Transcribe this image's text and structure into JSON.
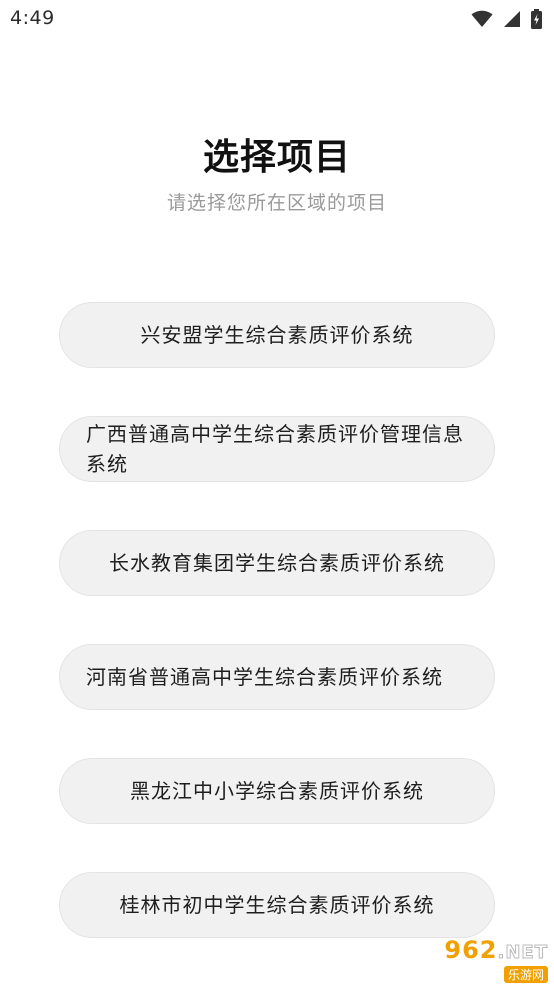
{
  "status_bar": {
    "time": "4:49",
    "icons": [
      "wifi-icon",
      "signal-icon",
      "battery-charging-icon"
    ]
  },
  "header": {
    "title": "选择项目",
    "subtitle": "请选择您所在区域的项目"
  },
  "projects": [
    {
      "label": "兴安盟学生综合素质评价系统"
    },
    {
      "label": "广西普通高中学生综合素质评价管理信息系统"
    },
    {
      "label": "长水教育集团学生综合素质评价系统"
    },
    {
      "label": "河南省普通高中学生综合素质评价系统"
    },
    {
      "label": "黑龙江中小学综合素质评价系统"
    },
    {
      "label": "桂林市初中学生综合素质评价系统"
    }
  ],
  "watermark": {
    "logo_main": "962",
    "logo_suffix": ".NET",
    "caption": "乐游网"
  },
  "colors": {
    "button_bg": "#f1f1f1",
    "button_border": "#e4e4e4",
    "title": "#111111",
    "subtitle": "#9a9a9a",
    "watermark_accent": "#f0a000"
  }
}
